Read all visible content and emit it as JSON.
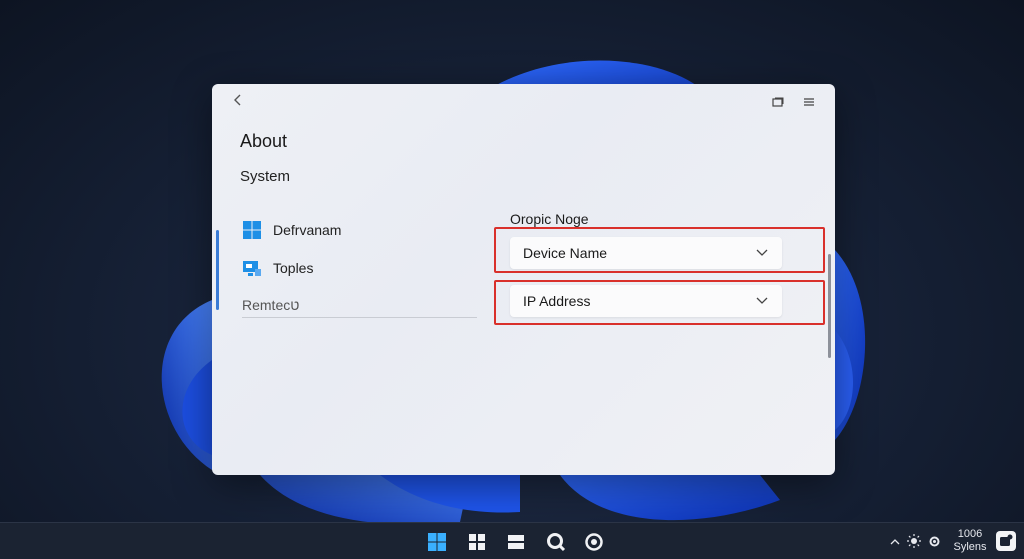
{
  "window": {
    "page_title": "About",
    "section_title": "System",
    "nav": [
      {
        "label": "Defrvanam",
        "icon": "windows-logo-icon"
      },
      {
        "label": "Toples",
        "icon": "display-icon"
      },
      {
        "label": "Remtecט",
        "icon": ""
      }
    ],
    "group_label": "Oropic Noge",
    "dropdowns": [
      {
        "value": "Device Name"
      },
      {
        "value": "IP Address"
      }
    ]
  },
  "taskbar": {
    "apps": [
      "windows-start-icon",
      "widgets-icon",
      "task-view-icon",
      "search-icon",
      "settings-icon"
    ],
    "clock_time": "1006",
    "clock_label": "Sylens"
  },
  "colors": {
    "highlight": "#d9302b",
    "accent": "#3a7bd5"
  }
}
